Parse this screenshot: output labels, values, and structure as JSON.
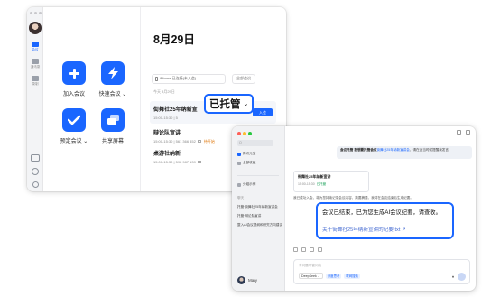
{
  "meeting_app": {
    "rail": {
      "items": [
        {
          "label": "会议",
          "icon": "video-icon",
          "active": true
        },
        {
          "label": "通讯录",
          "icon": "contacts-icon",
          "active": false
        },
        {
          "label": "录制",
          "icon": "record-icon",
          "active": false
        }
      ],
      "bottom_icons": [
        "mail-icon",
        "settings-icon",
        "profile-icon"
      ]
    },
    "actions": [
      {
        "label": "加入会议",
        "icon": "plus-icon"
      },
      {
        "label": "快速会议 ⌄",
        "icon": "lightning-icon"
      },
      {
        "label": "预定会议 ⌄",
        "icon": "check-icon"
      },
      {
        "label": "共享屏幕",
        "icon": "share-screen-icon"
      }
    ],
    "date": "8月29日",
    "room_selector": "iPhone 已连接(未入会)",
    "all_meetings_button": "全部会议",
    "today_label": "今天 8月29日",
    "meetings": [
      {
        "title": "街舞社25年纳新宣",
        "time": "15:00-15:30 | 5",
        "enter_label": "入会"
      },
      {
        "title": "辩论队宣讲",
        "time": "15:00-15:30 | 561 366 452",
        "status": "待开始"
      },
      {
        "title": "桌游社纳新",
        "time": "15:00-15:30 | 592 987 139"
      }
    ],
    "hosted_badge": {
      "label": "已托管",
      "chevron": "⌄"
    }
  },
  "chat_app": {
    "sidebar": {
      "search_placeholder": "Q",
      "items": [
        {
          "label": "腾讯元宝",
          "icon": "yuanbao-icon"
        },
        {
          "label": "全部收藏",
          "icon": "star-icon"
        },
        {
          "label": "分组示例",
          "icon": "folder-icon"
        }
      ],
      "section_label": "聊天",
      "chats": [
        "托管·街舞社25年纳新宣讲会",
        "托管·辩论队宣讲",
        "整入AI会议提纲和研究方向建议"
      ],
      "user": "Mary"
    },
    "user_bubble": {
      "text_a": "会议托管  我想要托管会议",
      "text_link": "街舞社25年纳新宣讲会",
      "text_b": "，请在适当时候提醒我发言"
    },
    "meeting_card": {
      "title": "街舞社25年纳新宣讲",
      "time": "15:00-15:30",
      "status": "已托管"
    },
    "bot_lines": [
      "我已成功入会，将为您持续记录会议内容，简要摘要。我将在会议结束后生成纪要。"
    ],
    "notice": {
      "main": "会议已结束，已为您生成AI会议纪要，请查收。",
      "link": "关于街舞社25年纳新宣讲的纪要.txt ↗"
    },
    "input": {
      "placeholder": "有问题尽管问我",
      "model": "DeepSeek ⌄",
      "chips": [
        "深度思考",
        "联网搜索"
      ]
    }
  }
}
